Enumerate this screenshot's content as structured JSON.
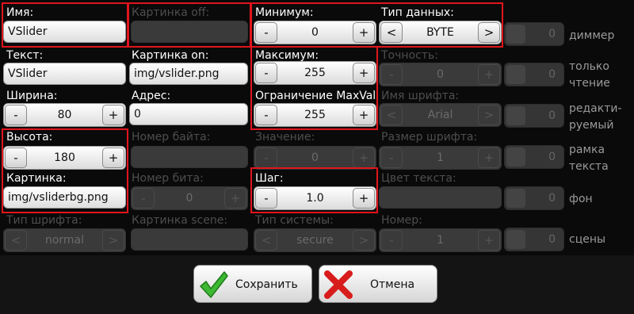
{
  "col1": {
    "name_label": "Имя:",
    "name_value": "VSlider",
    "text_label": "Текст:",
    "text_value": "VSlider",
    "width_label": "Ширина:",
    "width_value": "80",
    "height_label": "Высота:",
    "height_value": "180",
    "image_label": "Картинка:",
    "image_value": "img/vsliderbg.png",
    "font_type_label": "Тип шрифта:",
    "font_type_value": "normal"
  },
  "col2": {
    "image_off_label": "Картинка off:",
    "image_off_value": "",
    "image_on_label": "Картинка on:",
    "image_on_value": "img/vslider.png",
    "address_label": "Адрес:",
    "address_value": "0",
    "byte_num_label": "Номер байта:",
    "byte_num_value": "",
    "bit_num_label": "Номер бита:",
    "bit_num_value": "0",
    "image_scene_label": "Картинка scene:",
    "image_scene_value": ""
  },
  "col3": {
    "min_label": "Минимум:",
    "min_value": "0",
    "max_label": "Максимум:",
    "max_value": "255",
    "limit_label": "Ограничение MaxVal",
    "limit_value": "255",
    "value_label": "Значение:",
    "value_value": "0",
    "step_label": "Шаг:",
    "step_value": "1.0",
    "system_type_label": "Тип системы:",
    "system_type_value": "secure"
  },
  "col4": {
    "data_type_label": "Тип данных:",
    "data_type_value": "BYTE",
    "precision_label": "Точность:",
    "precision_value": "0",
    "font_name_label": "Имя шрифта:",
    "font_name_value": "Arial",
    "font_size_label": "Размер шрифта:",
    "font_size_value": "1",
    "text_color_label": "Цвет текста:",
    "text_color_value": "",
    "number_label": "Номер:",
    "number_value": "1"
  },
  "toggles": [
    {
      "label": "диммер",
      "value": "0"
    },
    {
      "label": "только чтение",
      "value": "0"
    },
    {
      "label": "редакти-руемый",
      "value": "0"
    },
    {
      "label": "рамка текста",
      "value": "0"
    },
    {
      "label": "фон",
      "value": "0"
    },
    {
      "label": "сцены",
      "value": "0"
    }
  ],
  "buttons": {
    "save": "Сохранить",
    "cancel": "Отмена"
  },
  "stepper": {
    "minus": "-",
    "plus": "+",
    "prev": "<",
    "next": ">"
  },
  "colors": {
    "highlight": "#e2141c",
    "background": "#0a0a0a",
    "save_icon": "#3cb832",
    "cancel_icon": "#d81c1c"
  }
}
